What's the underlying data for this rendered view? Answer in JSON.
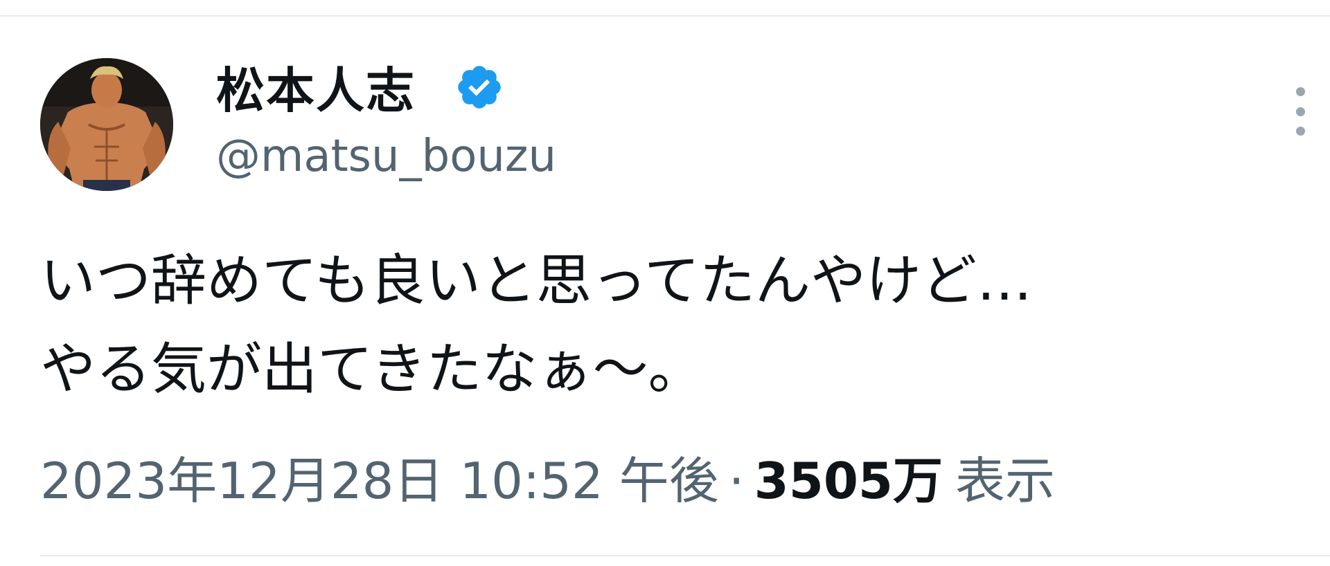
{
  "author": {
    "display_name": "松本人志",
    "handle": "@matsu_bouzu",
    "verified": true,
    "avatar_icon": "bodybuilder-figure-avatar"
  },
  "tweet": {
    "lines": [
      "いつ辞めても良いと思ってたんやけど…",
      "やる気が出てきたなぁ〜。"
    ]
  },
  "meta": {
    "timestamp": "2023年12月28日 10:52 午後",
    "separator": "·",
    "views_count": "3505万",
    "views_label": "表示"
  },
  "icons": {
    "verified": "verified-badge-icon",
    "more": "more-options-icon"
  },
  "colors": {
    "text_primary": "#0f1419",
    "text_secondary": "#536471",
    "verified_blue": "#1d9bf0",
    "divider": "#e6e9eb"
  }
}
